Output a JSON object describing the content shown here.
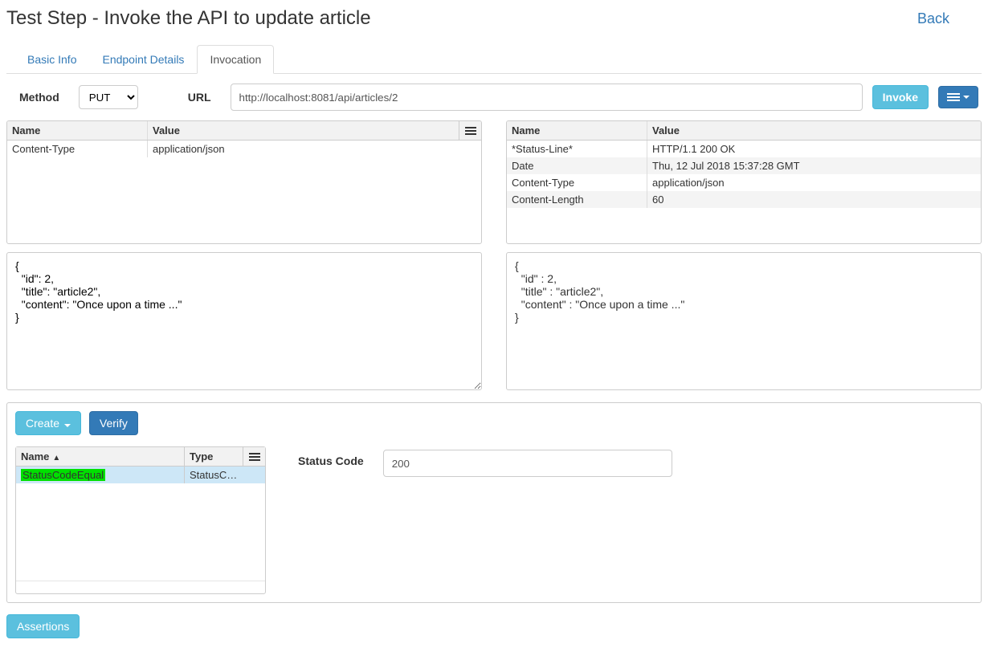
{
  "header": {
    "title": "Test Step - Invoke the API to update article",
    "back": "Back"
  },
  "tabs": {
    "basic": "Basic Info",
    "endpoint": "Endpoint Details",
    "invocation": "Invocation"
  },
  "urlrow": {
    "method_label": "Method",
    "method_value": "PUT",
    "url_label": "URL",
    "url_value": "http://localhost:8081/api/articles/2",
    "invoke": "Invoke"
  },
  "req_headers": {
    "name_col": "Name",
    "value_col": "Value",
    "rows": [
      {
        "name": "Content-Type",
        "value": "application/json"
      }
    ]
  },
  "req_body": "{\n  \"id\": 2,\n  \"title\": \"article2\",\n  \"content\": \"Once upon a time ...\"\n}",
  "res_headers": {
    "name_col": "Name",
    "value_col": "Value",
    "rows": [
      {
        "name": "*Status-Line*",
        "value": "HTTP/1.1 200 OK"
      },
      {
        "name": "Date",
        "value": "Thu, 12 Jul 2018 15:37:28 GMT"
      },
      {
        "name": "Content-Type",
        "value": "application/json"
      },
      {
        "name": "Content-Length",
        "value": "60"
      }
    ]
  },
  "res_body": "{\n  \"id\" : 2,\n  \"title\" : \"article2\",\n  \"content\" : \"Once upon a time ...\"\n}",
  "assertions": {
    "create": "Create",
    "verify": "Verify",
    "name_col": "Name",
    "type_col": "Type",
    "row_name": "StatusCodeEqual",
    "row_type": "StatusC…",
    "status_label": "Status Code",
    "status_value": "200",
    "bottom": "Assertions"
  }
}
